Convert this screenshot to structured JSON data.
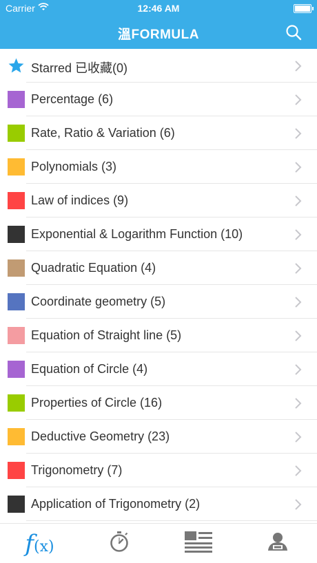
{
  "status": {
    "carrier": "Carrier",
    "time": "12:46 AM"
  },
  "header": {
    "title": "溫FORMULA"
  },
  "colors": {
    "header": "#3aaee8",
    "star": "#2aa6ea",
    "purple": "#a665d2",
    "green": "#99cc00",
    "yellow": "#ffbb33",
    "red": "#ff4444",
    "black": "#333333",
    "tan": "#c19b73",
    "blue": "#5574c0",
    "pink": "#f49ca1"
  },
  "items": [
    {
      "label": "Starred 已收藏(0)",
      "icon": "star-icon"
    },
    {
      "label": "Percentage (6)",
      "color": "#a665d2"
    },
    {
      "label": "Rate, Ratio & Variation (6)",
      "color": "#99cc00"
    },
    {
      "label": "Polynomials (3)",
      "color": "#ffbb33"
    },
    {
      "label": "Law of indices (9)",
      "color": "#ff4444"
    },
    {
      "label": "Exponential & Logarithm Function (10)",
      "color": "#333333"
    },
    {
      "label": "Quadratic Equation (4)",
      "color": "#c19b73"
    },
    {
      "label": "Coordinate geometry (5)",
      "color": "#5574c0"
    },
    {
      "label": "Equation of Straight line (5)",
      "color": "#f49ca1"
    },
    {
      "label": "Equation of Circle (4)",
      "color": "#a665d2"
    },
    {
      "label": "Properties of Circle (16)",
      "color": "#99cc00"
    },
    {
      "label": "Deductive Geometry (23)",
      "color": "#ffbb33"
    },
    {
      "label": "Trigonometry (7)",
      "color": "#ff4444"
    },
    {
      "label": "Application of Trigonometry (2)",
      "color": "#333333"
    }
  ],
  "tabs": [
    {
      "name": "formula",
      "icon": "function-icon",
      "f": "f",
      "x": "(x)"
    },
    {
      "name": "timer",
      "icon": "stopwatch-icon"
    },
    {
      "name": "list",
      "icon": "list-icon"
    },
    {
      "name": "profile",
      "icon": "user-icon"
    }
  ]
}
